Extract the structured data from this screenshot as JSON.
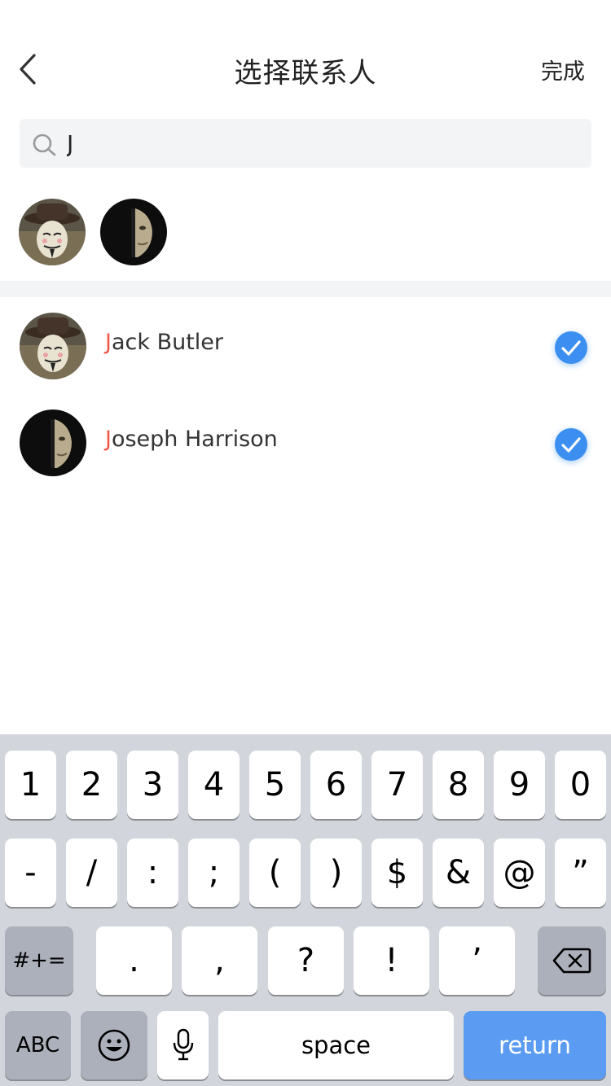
{
  "nav": {
    "title": "选择联系人",
    "done_label": "完成"
  },
  "search": {
    "value": "J",
    "placeholder": ""
  },
  "selected_contacts": [
    {
      "name": "Jack Butler",
      "avatar": "masked-man-photo"
    },
    {
      "name": "Joseph Harrison",
      "avatar": "half-face-photo"
    }
  ],
  "results": [
    {
      "match": "J",
      "rest": "ack Butler",
      "checked": true,
      "avatar": "masked-man-photo"
    },
    {
      "match": "J",
      "rest": "oseph Harrison",
      "checked": true,
      "avatar": "half-face-photo"
    }
  ],
  "keyboard": {
    "row1": [
      "1",
      "2",
      "3",
      "4",
      "5",
      "6",
      "7",
      "8",
      "9",
      "0"
    ],
    "row2": [
      "-",
      "/",
      ":",
      ";",
      "(",
      ")",
      "$",
      "&",
      "@",
      "”"
    ],
    "row3_mode": "#+=",
    "row3": [
      ".",
      ",",
      "?",
      "!",
      "’"
    ],
    "abc_label": "ABC",
    "space_label": "space",
    "return_label": "return",
    "icons": [
      "delete-icon",
      "emoji-icon",
      "microphone-icon"
    ]
  },
  "colors": {
    "highlight": "#f15a4a",
    "check": "#3c8ff0",
    "return_key": "#5b9cf2",
    "keyboard_bg": "#d2d5db"
  }
}
